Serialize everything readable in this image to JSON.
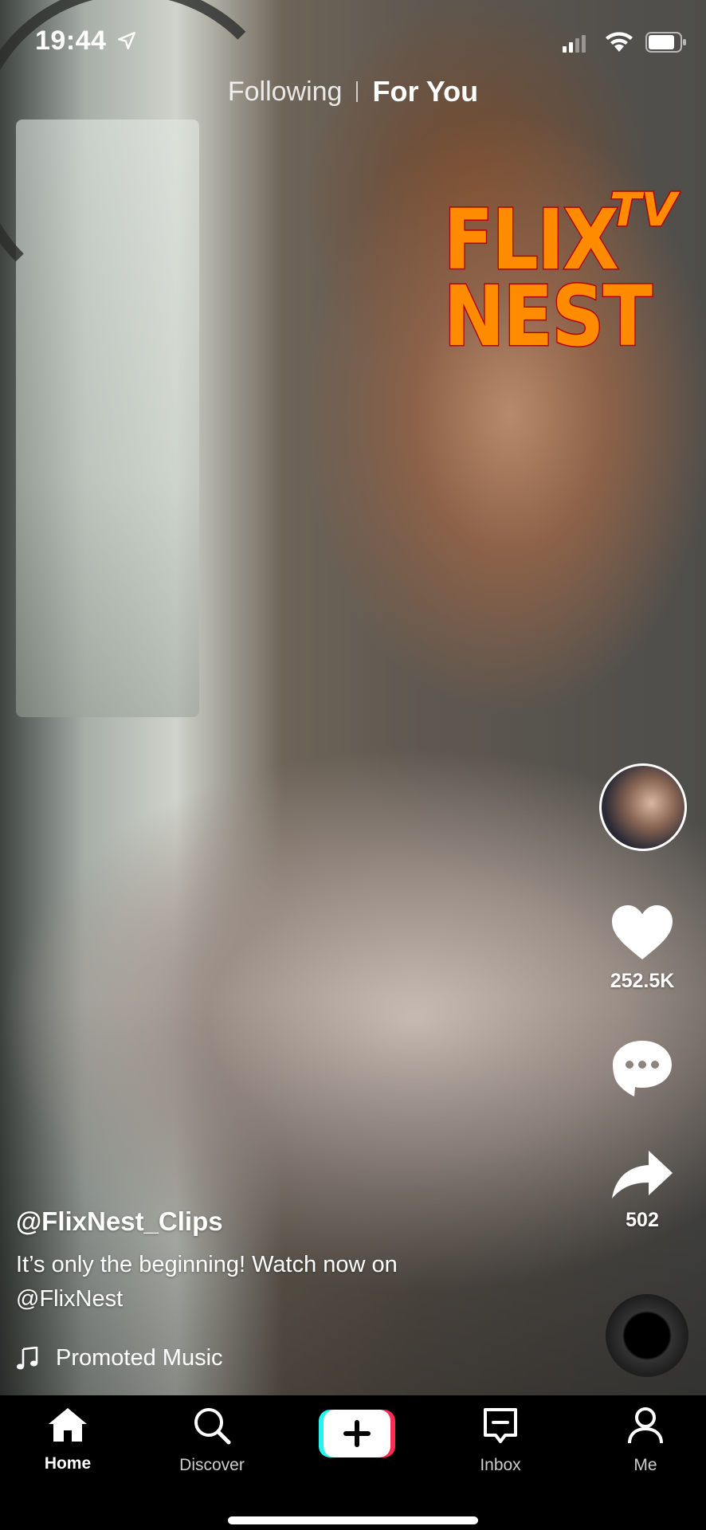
{
  "status_bar": {
    "time": "19:44"
  },
  "top_tabs": {
    "following": "Following",
    "for_you": "For You",
    "active": "For You"
  },
  "logo": {
    "line1": "FLIX",
    "line2": "NEST",
    "badge": "TV",
    "fill_color": "#ff8c00",
    "outline_color": "#b30000"
  },
  "actions": {
    "like_count": "252.5K",
    "share_count": "502"
  },
  "post": {
    "username": "@FlixNest_Clips",
    "description": "It’s only the beginning! Watch now on @FlixNest",
    "music": "Promoted Music"
  },
  "tab_bar": {
    "items": [
      {
        "label": "Home",
        "icon": "home-icon",
        "active": true
      },
      {
        "label": "Discover",
        "icon": "search-icon",
        "active": false
      },
      {
        "label": "",
        "icon": "plus-icon",
        "active": false
      },
      {
        "label": "Inbox",
        "icon": "inbox-icon",
        "active": false
      },
      {
        "label": "Me",
        "icon": "person-icon",
        "active": false
      }
    ]
  },
  "colors": {
    "create_left": "#25f4ee",
    "create_right": "#fe2c55"
  }
}
